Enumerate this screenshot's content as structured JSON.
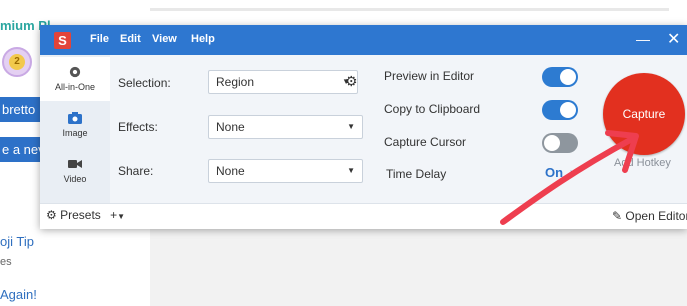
{
  "background_page": {
    "premium_text": "mium Pl",
    "button1": "bretto",
    "button2": "e a nev",
    "link1": "oji Tip",
    "small1": "es",
    "link2": "Again!"
  },
  "window": {
    "app_icon": "S",
    "menu": [
      "File",
      "Edit",
      "View",
      "Help"
    ],
    "min_icon": "minimize-icon",
    "close_icon": "close-icon"
  },
  "sidebar": {
    "tabs": [
      {
        "label": "All-in-One",
        "icon": "all-in-one-icon",
        "active": true
      },
      {
        "label": "Image",
        "icon": "camera-icon",
        "active": false
      },
      {
        "label": "Video",
        "icon": "video-camera-icon",
        "active": false
      }
    ]
  },
  "settings": {
    "selection_label": "Selection:",
    "selection_value": "Region",
    "effects_label": "Effects:",
    "effects_value": "None",
    "share_label": "Share:",
    "share_value": "None"
  },
  "options": {
    "preview_label": "Preview in Editor",
    "preview_on": true,
    "clipboard_label": "Copy to Clipboard",
    "clipboard_on": true,
    "cursor_label": "Capture Cursor",
    "cursor_on": false,
    "timedelay_label": "Time Delay",
    "timedelay_value": "On"
  },
  "capture": {
    "button_label": "Capture",
    "hotkey_label": "Add Hotkey"
  },
  "footer": {
    "presets_label": "Presets",
    "add_label": "+",
    "open_editor_label": "Open Editor"
  },
  "colors": {
    "titlebar": "#2e77d0",
    "capture": "#e2301f",
    "toggle_on": "#2d7bd1",
    "annotation_arrow": "#ee3e4f"
  }
}
